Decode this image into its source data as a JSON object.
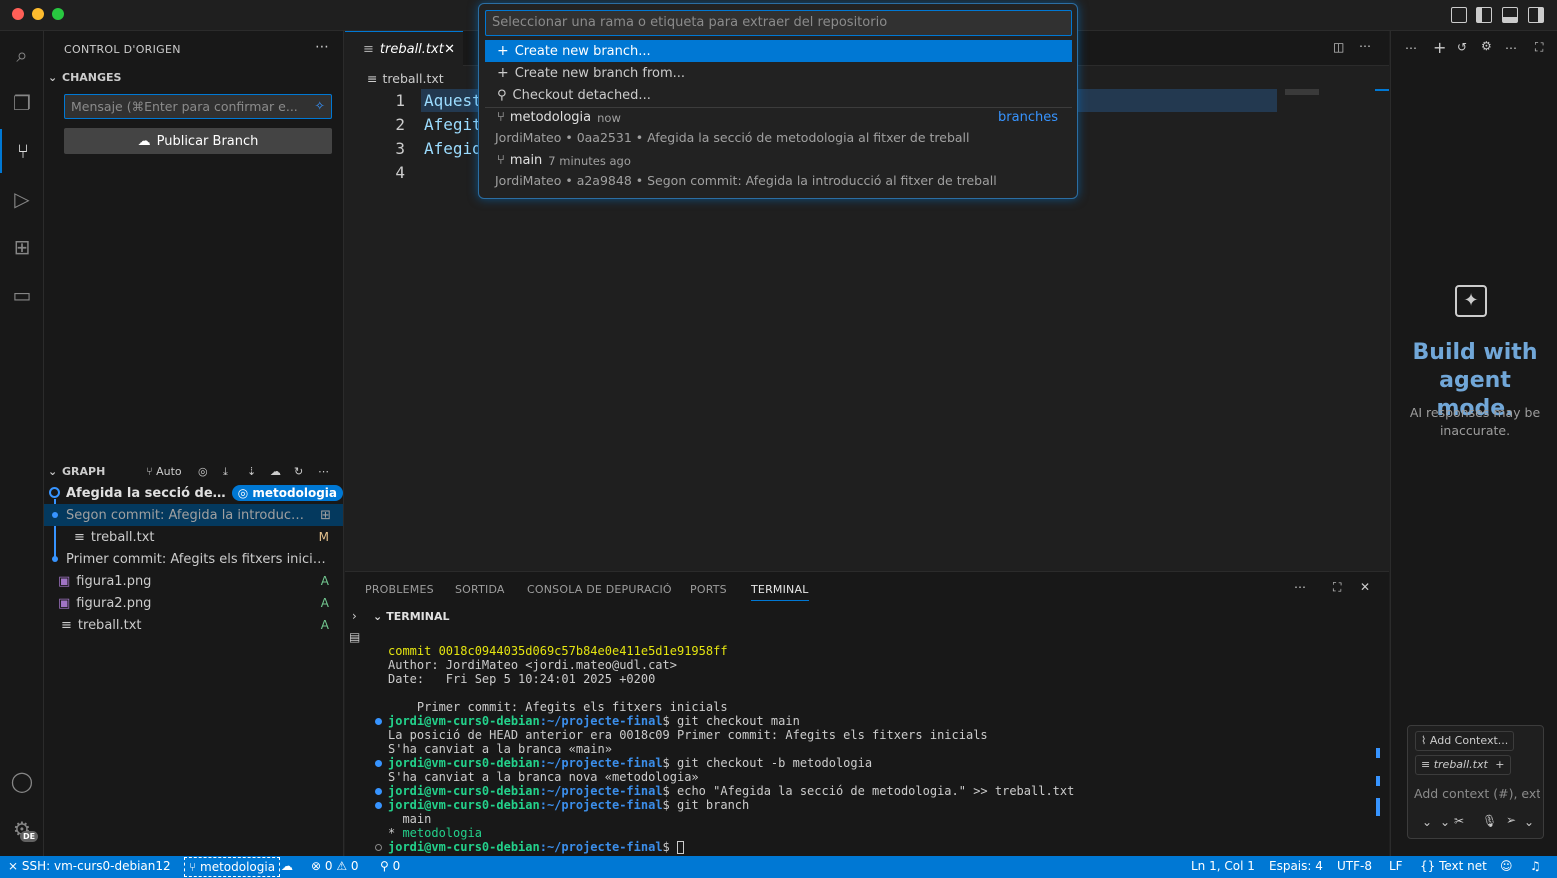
{
  "colors": {
    "accent": "#0078d4",
    "background": "#1f1f1f",
    "sidebar": "#181818",
    "added": "#73c991",
    "modified": "#e2c08d",
    "terminal_prompt": "#23d18b",
    "terminal_path": "#3b8eea",
    "commit_hash": "#e5e510"
  },
  "quickpick": {
    "placeholder": "Seleccionar una rama o etiqueta para extraer del repositorio",
    "actions": [
      {
        "icon": "plus-icon",
        "label": "Create new branch..."
      },
      {
        "icon": "plus-icon",
        "label": "Create new branch from..."
      },
      {
        "icon": "git-commit-icon",
        "label": "Checkout detached..."
      }
    ],
    "group_label": "branches",
    "branches": [
      {
        "icon": "git-branch-icon",
        "name": "metodologia",
        "time": "now",
        "author": "JordiMateo",
        "hash": "0aa2531",
        "message": "Afegida la secció de metodologia al fitxer de treball"
      },
      {
        "icon": "git-branch-icon",
        "name": "main",
        "time": "7 minutes ago",
        "author": "JordiMateo",
        "hash": "a2a9848",
        "message": "Segon commit: Afegida la introducció al fitxer de treball"
      }
    ]
  },
  "sidebar": {
    "title": "CONTROL D'ORIGEN",
    "changes_header": "CHANGES",
    "commit_placeholder": "Mensaje (⌘Enter para confirmar e...",
    "publish_label": "Publicar Branch",
    "graph_header": "GRAPH",
    "graph_auto": "Auto",
    "graph": [
      {
        "text": "Afegida la secció de met...",
        "badge": "metodologia"
      },
      {
        "text": "Segon commit: Afegida la introducció..."
      },
      {
        "text": "treball.txt",
        "status": "M"
      },
      {
        "text": "Primer commit: Afegits els fitxers inicials..."
      },
      {
        "text": "figura1.png",
        "status": "A"
      },
      {
        "text": "figura2.png",
        "status": "A"
      },
      {
        "text": "treball.txt",
        "status": "A"
      }
    ]
  },
  "editor": {
    "tab_label": "treball.txt",
    "breadcrumb": "treball.txt",
    "line_numbers": [
      "1",
      "2",
      "3",
      "4"
    ],
    "lines": [
      "Aquest",
      "Afegit",
      "Afegid",
      ""
    ]
  },
  "panel": {
    "tabs": [
      "PROBLEMES",
      "SORTIDA",
      "CONSOLA DE DEPURACIÓ",
      "PORTS",
      "TERMINAL"
    ],
    "terminal_header": "TERMINAL",
    "commit_line": "commit 0018c0944035d069c57b84e0e411e5d1e91958ff",
    "author_line": "Author: JordiMateo <jordi.mateo@udl.cat>",
    "date_line": "Date:   Fri Sep 5 10:24:01 2025 +0200",
    "msg_line": "    Primer commit: Afegits els fitxers inicials",
    "prompt_user": "jordi@vm-curs0-debian",
    "prompt_path": ":~/projecte-final",
    "cmd1": "$ git checkout main",
    "out1a": "La posició de HEAD anterior era 0018c09 Primer commit: Afegits els fitxers inicials",
    "out1b": "S'ha canviat a la branca «main»",
    "cmd2": "$ git checkout -b metodologia",
    "out2": "S'ha canviat a la branca nova «metodologia»",
    "cmd3": "$ echo \"Afegida la secció de metodologia.\" >> treball.txt",
    "cmd4": "$ git branch",
    "out4a": "  main",
    "out4b_star": "* ",
    "out4b_branch": "metodologia",
    "cmd5": "$ "
  },
  "chat": {
    "title": "Build with agent mode.",
    "subtitle": "AI responses may be inaccurate.",
    "add_context": "Add Context...",
    "file_chip": "treball.txt",
    "input_placeholder": "Add context (#), exte"
  },
  "statusbar": {
    "remote": "SSH: vm-curs0-debian12",
    "branch": "metodologia",
    "errors": "0",
    "warnings": "0",
    "ports": "0",
    "position": "Ln 1, Col 1",
    "spaces": "Espais: 4",
    "encoding": "UTF-8",
    "eol": "LF",
    "language": "Text net"
  },
  "activity": {
    "account_badge": "DE"
  }
}
